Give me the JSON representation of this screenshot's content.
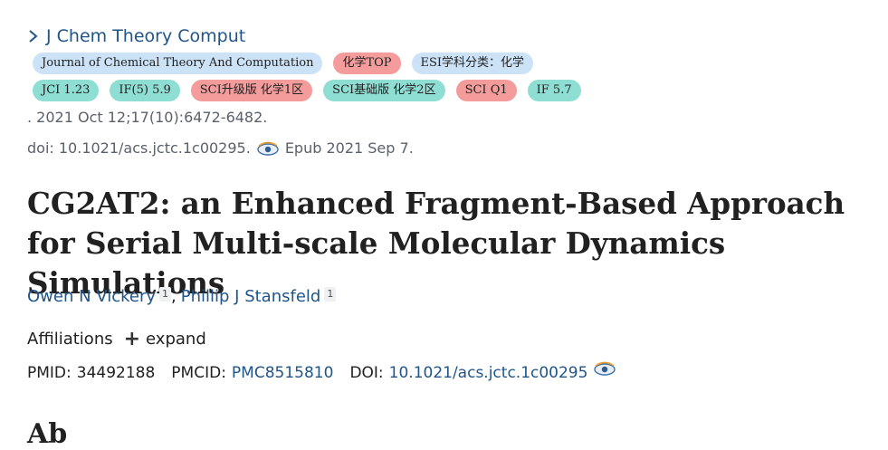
{
  "journal": {
    "link_text": "J Chem Theory Comput"
  },
  "tags_row1": [
    {
      "text": "Journal of Chemical Theory And Computation",
      "color": "#cce3f7"
    },
    {
      "text": "化学TOP",
      "color": "#f49c9c"
    },
    {
      "text": "ESI学科分类：化学",
      "color": "#cce3f7"
    }
  ],
  "tags_row2": [
    {
      "text": "JCI 1.23",
      "color": "#8fded3"
    },
    {
      "text": "IF(5) 5.9",
      "color": "#8fded3"
    },
    {
      "text": "SCI升级版 化学1区",
      "color": "#f49c9c"
    },
    {
      "text": "SCI基础版 化学2区",
      "color": "#8fded3"
    },
    {
      "text": "SCI Q1",
      "color": "#f49c9c"
    },
    {
      "text": "IF 5.7",
      "color": "#8fded3"
    }
  ],
  "citation": {
    "date_line": ". 2021 Oct 12;17(10):6472-6482.",
    "doi_line": "doi: 10.1021/acs.jctc.1c00295.",
    "epub": "Epub 2021 Sep 7."
  },
  "title": "CG2AT2: an Enhanced Fragment-Based Approach for Serial Multi-scale Molecular Dynamics Simulations",
  "authors": [
    {
      "name": "Owen N Vickery",
      "affil": "1"
    },
    {
      "name": "Phillip J Stansfeld",
      "affil": "1"
    }
  ],
  "affiliations": {
    "label": "Affiliations",
    "expand": "expand"
  },
  "ids": {
    "pmid_label": "PMID:",
    "pmid": "34492188",
    "pmcid_label": "PMCID:",
    "pmcid": "PMC8515810",
    "doi_label": "DOI:",
    "doi": "10.1021/acs.jctc.1c00295"
  },
  "partial_heading": "Ab"
}
